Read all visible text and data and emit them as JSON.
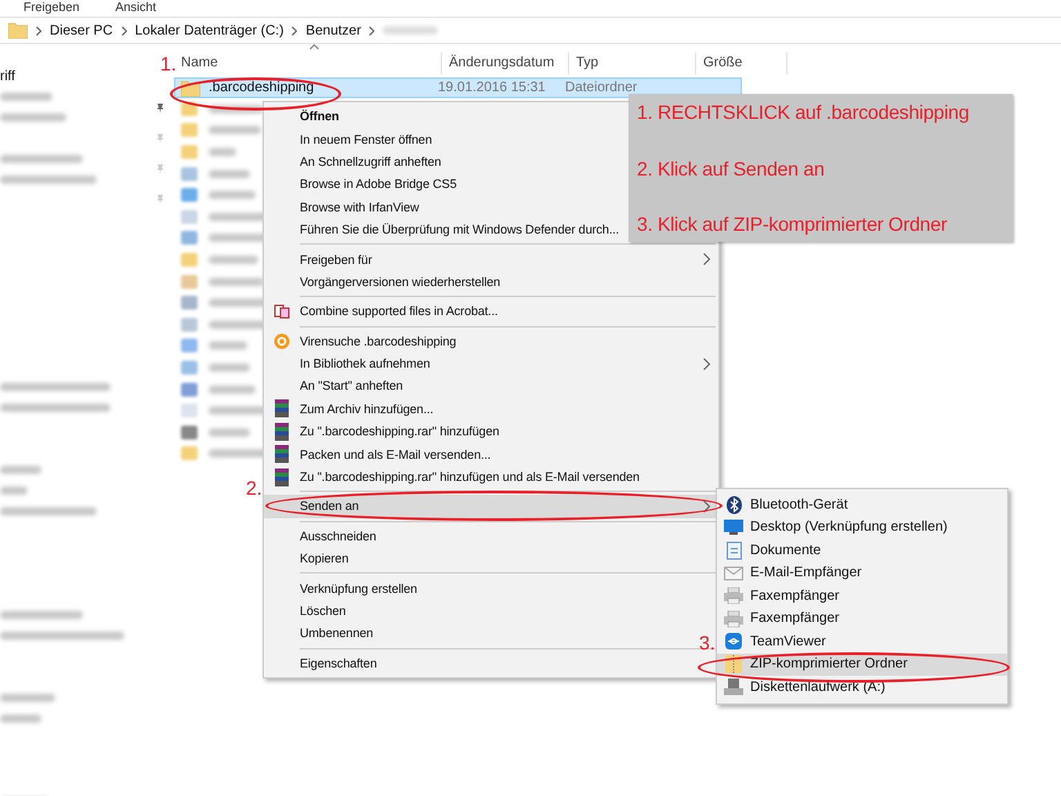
{
  "ribbon_tabs": [
    {
      "label": "Freigeben"
    },
    {
      "label": "Ansicht"
    }
  ],
  "address_bar": {
    "path": [
      "Dieser PC",
      "Lokaler Datenträger (C:)",
      "Benutzer"
    ]
  },
  "nav_pane": {
    "visible_text": "riff"
  },
  "file_list": {
    "columns": [
      "Name",
      "Änderungsdatum",
      "Typ",
      "Größe"
    ],
    "rows": [
      {
        "name": ".barcodeshipping",
        "date": "19.01.2016 15:31",
        "type": "Dateiordner",
        "selected": true
      }
    ]
  },
  "context_menu": {
    "items": [
      {
        "kind": "item",
        "label": "Öffnen",
        "default": true,
        "highlighted": false
      },
      {
        "kind": "item",
        "label": "In neuem Fenster öffnen",
        "default": false,
        "highlighted": false
      },
      {
        "kind": "item",
        "label": "An Schnellzugriff anheften",
        "default": false,
        "highlighted": false
      },
      {
        "kind": "item",
        "label": "Browse in Adobe Bridge CS5",
        "default": false,
        "highlighted": false
      },
      {
        "kind": "item",
        "label": "Browse with IrfanView",
        "default": false,
        "highlighted": false
      },
      {
        "kind": "item",
        "label": "Führen Sie die Überprüfung mit Windows Defender durch...",
        "default": false,
        "highlighted": false
      },
      {
        "kind": "separator"
      },
      {
        "kind": "item",
        "label": "Freigeben für",
        "default": false,
        "submenu": true,
        "highlighted": false
      },
      {
        "kind": "item",
        "label": "Vorgängerversionen wiederherstellen",
        "default": false,
        "submenu": false,
        "highlighted": false
      },
      {
        "kind": "separator"
      },
      {
        "kind": "item",
        "label": "Combine supported files in Acrobat...",
        "default": false,
        "submenu": false,
        "highlighted": false
      },
      {
        "kind": "separator"
      },
      {
        "kind": "item",
        "label": "Virensuche .barcodeshipping",
        "default": false,
        "submenu": false,
        "highlighted": false
      },
      {
        "kind": "item",
        "label": "In Bibliothek aufnehmen",
        "default": false,
        "submenu": true,
        "highlighted": false
      },
      {
        "kind": "item",
        "label": "An \"Start\" anheften",
        "default": false,
        "submenu": false,
        "highlighted": false
      },
      {
        "kind": "item",
        "label": "Zum Archiv hinzufügen...",
        "default": false,
        "submenu": false,
        "highlighted": false
      },
      {
        "kind": "item",
        "label": "Zu \".barcodeshipping.rar\" hinzufügen",
        "default": false,
        "submenu": false,
        "highlighted": false
      },
      {
        "kind": "item",
        "label": "Packen und als E-Mail versenden...",
        "default": false,
        "submenu": false,
        "highlighted": false
      },
      {
        "kind": "item",
        "label": "Zu \".barcodeshipping.rar\" hinzufügen und als E-Mail versenden",
        "default": false,
        "submenu": false,
        "highlighted": false
      },
      {
        "kind": "separator"
      },
      {
        "kind": "item",
        "label": "Senden an",
        "default": false,
        "submenu": true,
        "highlighted": true
      },
      {
        "kind": "separator"
      },
      {
        "kind": "item",
        "label": "Ausschneiden",
        "default": false,
        "submenu": false,
        "highlighted": false
      },
      {
        "kind": "item",
        "label": "Kopieren",
        "default": false,
        "submenu": false,
        "highlighted": false
      },
      {
        "kind": "separator"
      },
      {
        "kind": "item",
        "label": "Verknüpfung erstellen",
        "default": false,
        "submenu": false,
        "highlighted": false
      },
      {
        "kind": "item",
        "label": "Löschen",
        "default": false,
        "submenu": false,
        "highlighted": false
      },
      {
        "kind": "item",
        "label": "Umbenennen",
        "default": false,
        "submenu": false,
        "highlighted": false
      },
      {
        "kind": "separator"
      },
      {
        "kind": "item",
        "label": "Eigenschaften",
        "default": false,
        "submenu": false,
        "highlighted": false
      }
    ]
  },
  "send_to_menu": {
    "items": [
      {
        "label": "Bluetooth-Gerät",
        "highlighted": false
      },
      {
        "label": "Desktop (Verknüpfung erstellen)",
        "highlighted": false
      },
      {
        "label": "Dokumente",
        "highlighted": false
      },
      {
        "label": "E-Mail-Empfänger",
        "highlighted": false
      },
      {
        "label": "Faxempfänger",
        "highlighted": false
      },
      {
        "label": "Faxempfänger",
        "highlighted": false
      },
      {
        "label": "TeamViewer",
        "highlighted": false
      },
      {
        "label": "ZIP-komprimierter Ordner",
        "highlighted": true
      },
      {
        "label": "Diskettenlaufwerk (A:)",
        "highlighted": false
      }
    ]
  },
  "annotations": {
    "steps": [
      "1. RECHTSKLICK auf .barcodeshipping",
      "2. Klick auf Senden an",
      "3. Klick auf ZIP-komprimierter Ordner"
    ],
    "markers": [
      "1.",
      "2.",
      "3."
    ]
  }
}
